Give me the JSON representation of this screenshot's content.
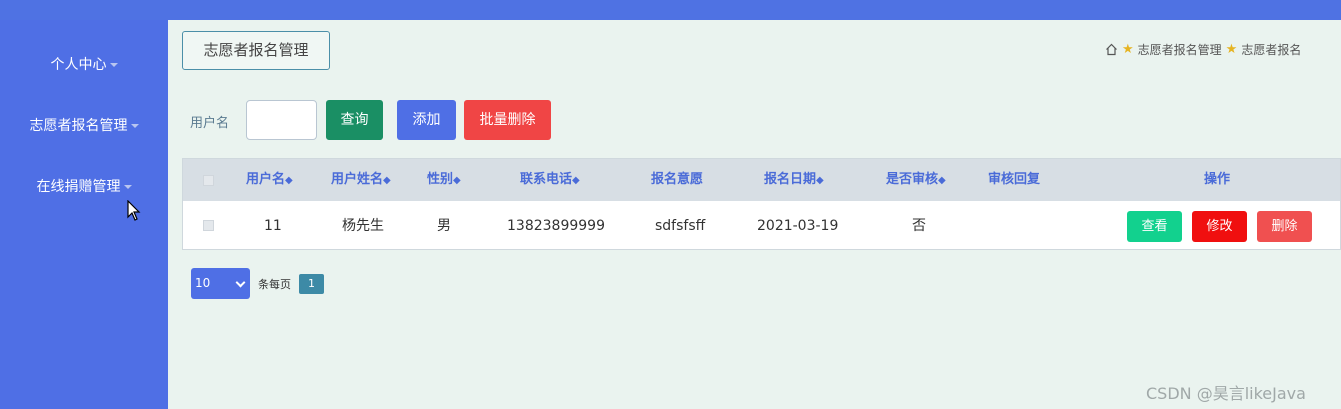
{
  "sidebar": {
    "items": [
      {
        "label": "个人中心"
      },
      {
        "label": "志愿者报名管理"
      },
      {
        "label": "在线捐赠管理"
      }
    ]
  },
  "header": {
    "title": "志愿者报名管理",
    "breadcrumb": [
      "志愿者报名管理",
      "志愿者报名"
    ]
  },
  "search": {
    "label": "用户名",
    "value": "",
    "query_label": "查询",
    "add_label": "添加",
    "batch_delete_label": "批量删除"
  },
  "table": {
    "columns": [
      "用户名",
      "用户姓名",
      "性别",
      "联系电话",
      "报名意愿",
      "报名日期",
      "是否审核",
      "审核回复",
      "操作"
    ],
    "rows": [
      {
        "username": "11",
        "name": "杨先生",
        "gender": "男",
        "phone": "13823899999",
        "intention": "sdfsfsff",
        "date": "2021-03-19",
        "reviewed": "否",
        "reply": "",
        "actions": {
          "view": "查看",
          "edit": "修改",
          "delete": "删除"
        }
      }
    ]
  },
  "pagination": {
    "page_size": "10",
    "per_page_label": "条每页",
    "current_page": "1"
  },
  "watermark": "CSDN @昊言likeJava",
  "colors": {
    "sidebar": "#4f6fe5",
    "query": "#1a8f64",
    "add": "#4f6fe5",
    "danger": "#f04545",
    "view": "#12d18e"
  }
}
